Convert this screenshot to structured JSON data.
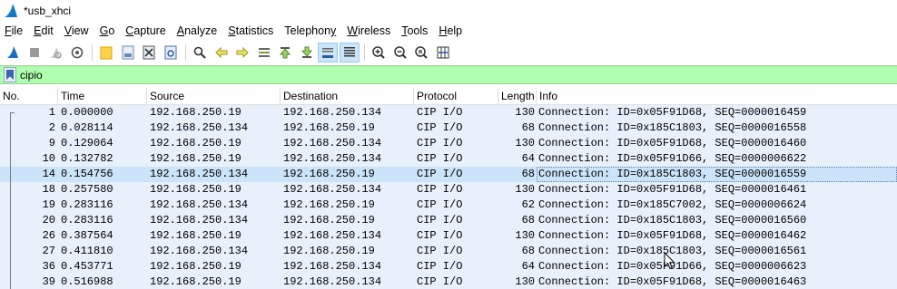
{
  "window": {
    "title": "*usb_xhci"
  },
  "menu": [
    {
      "label": "File",
      "u": "F",
      "rest": "ile"
    },
    {
      "label": "Edit",
      "u": "E",
      "rest": "dit"
    },
    {
      "label": "View",
      "u": "V",
      "rest": "iew"
    },
    {
      "label": "Go",
      "u": "G",
      "rest": "o"
    },
    {
      "label": "Capture",
      "u": "C",
      "rest": "apture"
    },
    {
      "label": "Analyze",
      "u": "A",
      "rest": "nalyze"
    },
    {
      "label": "Statistics",
      "u": "S",
      "rest": "tatistics"
    },
    {
      "label": "Telephony",
      "pre": "Telephon",
      "u": "y",
      "rest": ""
    },
    {
      "label": "Wireless",
      "u": "W",
      "rest": "ireless"
    },
    {
      "label": "Tools",
      "u": "T",
      "rest": "ools"
    },
    {
      "label": "Help",
      "u": "H",
      "rest": "elp"
    }
  ],
  "toolbar": {
    "icons": [
      "shark-fin-start-icon",
      "stop-icon",
      "restart-icon",
      "options-icon",
      "open-icon",
      "save-icon",
      "close-file-icon",
      "reload-icon",
      "find-icon",
      "go-back-icon",
      "go-forward-icon",
      "go-to-packet-icon",
      "first-packet-icon",
      "last-packet-icon",
      "auto-scroll-icon",
      "colorize-icon",
      "zoom-in-icon",
      "zoom-out-icon",
      "normal-size-icon",
      "resize-columns-icon"
    ]
  },
  "filter": {
    "value": "cipio"
  },
  "columns": {
    "no": "No.",
    "time": "Time",
    "source": "Source",
    "destination": "Destination",
    "protocol": "Protocol",
    "length": "Length",
    "info": "Info"
  },
  "packets": [
    {
      "no": "1",
      "time": "0.000000",
      "source": "192.168.250.19",
      "destination": "192.168.250.134",
      "protocol": "CIP I/O",
      "length": "130",
      "info": "Connection: ID=0x05F91D68, SEQ=0000016459"
    },
    {
      "no": "2",
      "time": "0.028114",
      "source": "192.168.250.134",
      "destination": "192.168.250.19",
      "protocol": "CIP I/O",
      "length": "68",
      "info": "Connection: ID=0x185C1803, SEQ=0000016558"
    },
    {
      "no": "9",
      "time": "0.129064",
      "source": "192.168.250.19",
      "destination": "192.168.250.134",
      "protocol": "CIP I/O",
      "length": "130",
      "info": "Connection: ID=0x05F91D68, SEQ=0000016460"
    },
    {
      "no": "10",
      "time": "0.132782",
      "source": "192.168.250.19",
      "destination": "192.168.250.134",
      "protocol": "CIP I/O",
      "length": "64",
      "info": "Connection: ID=0x05F91D66, SEQ=0000006622"
    },
    {
      "no": "14",
      "time": "0.154756",
      "source": "192.168.250.134",
      "destination": "192.168.250.19",
      "protocol": "CIP I/O",
      "length": "68",
      "info": "Connection: ID=0x185C1803, SEQ=0000016559",
      "selected": true
    },
    {
      "no": "18",
      "time": "0.257580",
      "source": "192.168.250.19",
      "destination": "192.168.250.134",
      "protocol": "CIP I/O",
      "length": "130",
      "info": "Connection: ID=0x05F91D68, SEQ=0000016461"
    },
    {
      "no": "19",
      "time": "0.283116",
      "source": "192.168.250.134",
      "destination": "192.168.250.19",
      "protocol": "CIP I/O",
      "length": "62",
      "info": "Connection: ID=0x185C7002, SEQ=0000006624"
    },
    {
      "no": "20",
      "time": "0.283116",
      "source": "192.168.250.134",
      "destination": "192.168.250.19",
      "protocol": "CIP I/O",
      "length": "68",
      "info": "Connection: ID=0x185C1803, SEQ=0000016560"
    },
    {
      "no": "26",
      "time": "0.387564",
      "source": "192.168.250.19",
      "destination": "192.168.250.134",
      "protocol": "CIP I/O",
      "length": "130",
      "info": "Connection: ID=0x05F91D68, SEQ=0000016462"
    },
    {
      "no": "27",
      "time": "0.411810",
      "source": "192.168.250.134",
      "destination": "192.168.250.19",
      "protocol": "CIP I/O",
      "length": "68",
      "info": "Connection: ID=0x185C1803, SEQ=0000016561"
    },
    {
      "no": "36",
      "time": "0.453771",
      "source": "192.168.250.19",
      "destination": "192.168.250.134",
      "protocol": "CIP I/O",
      "length": "64",
      "info": "Connection: ID=0x05F91D66, SEQ=0000006623"
    },
    {
      "no": "39",
      "time": "0.516988",
      "source": "192.168.250.19",
      "destination": "192.168.250.134",
      "protocol": "CIP I/O",
      "length": "130",
      "info": "Connection: ID=0x05F91D68, SEQ=0000016463"
    }
  ],
  "colors": {
    "row_bg": "#e7f0fb",
    "row_selected": "#cce4fa",
    "filter_bg": "#afffaf"
  }
}
